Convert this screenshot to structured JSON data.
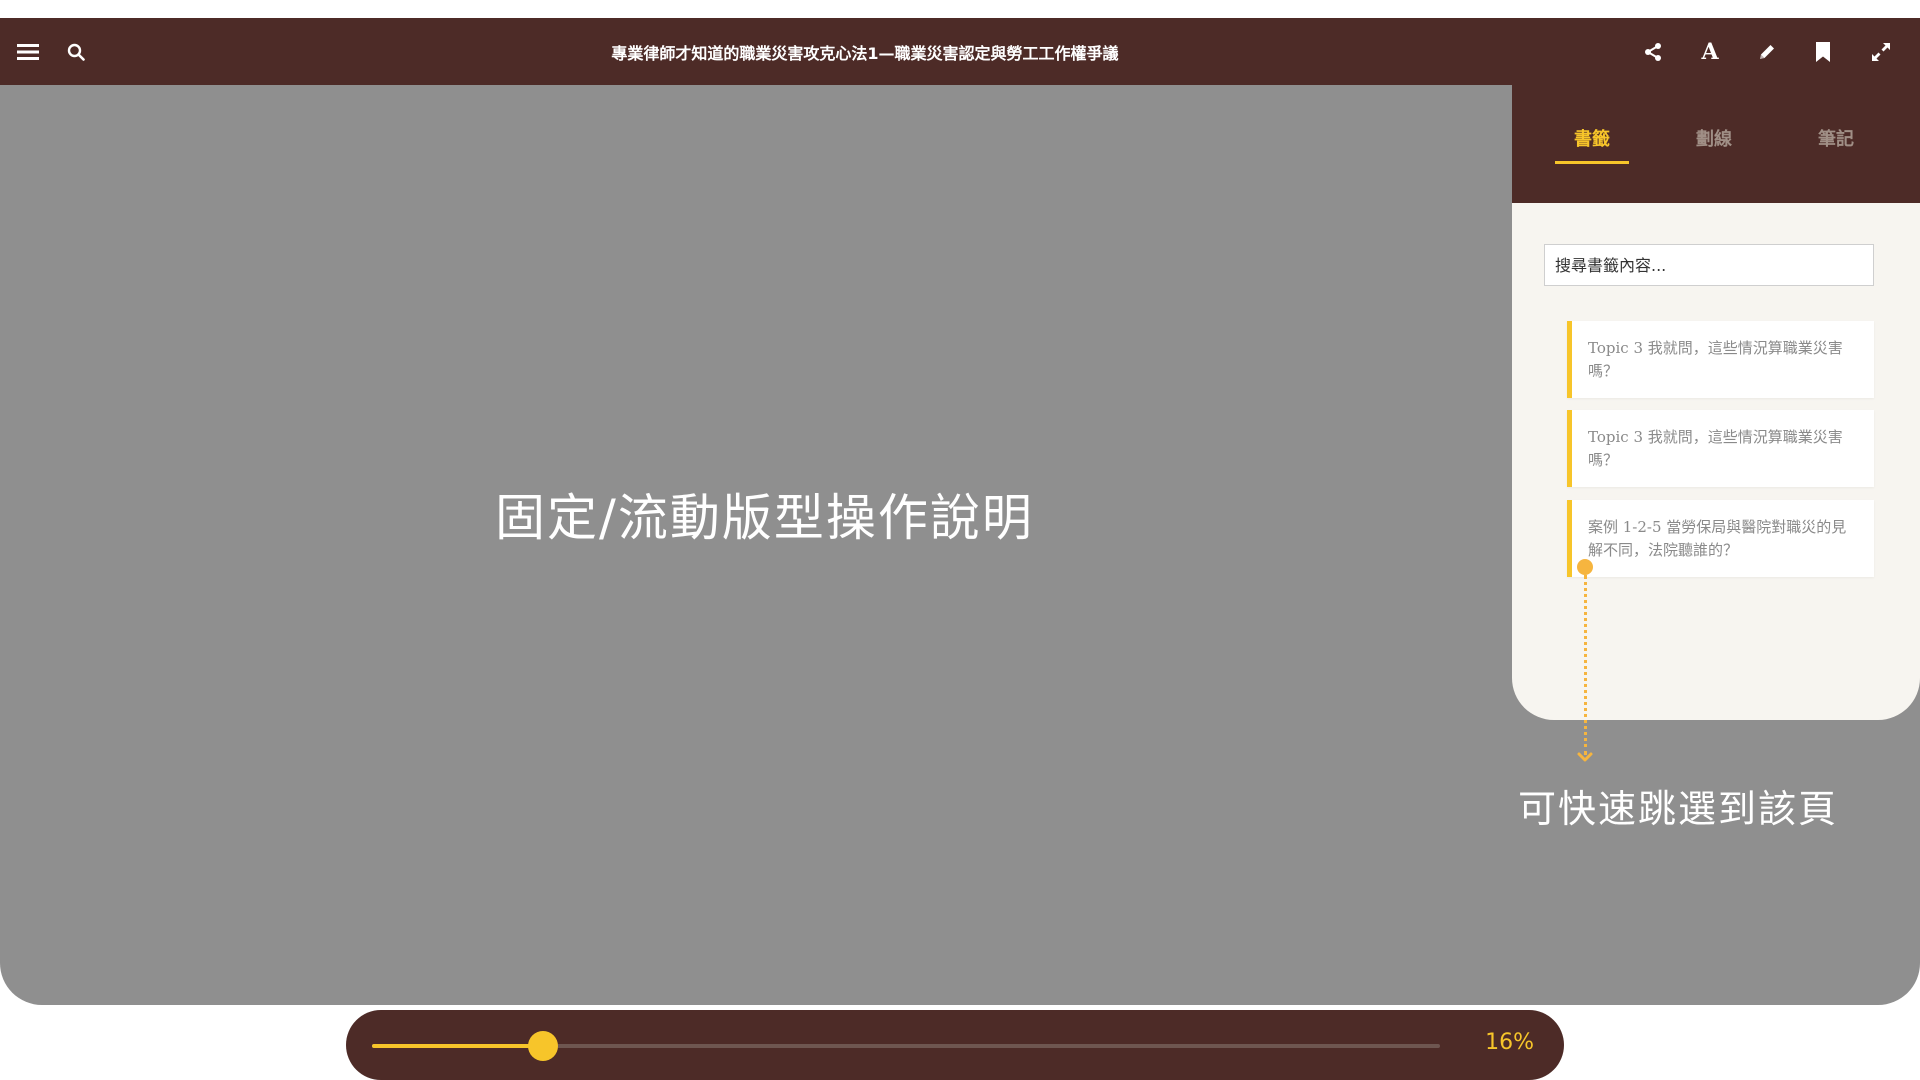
{
  "book": {
    "title": "專業律師才知道的職業災害攻克心法1—職業災害認定與勞工工作權爭議"
  },
  "toolbar": {
    "left": [
      {
        "name": "menu-icon",
        "glyph": "☰"
      },
      {
        "name": "search-icon",
        "glyph": "search"
      }
    ],
    "right": [
      {
        "name": "share-icon"
      },
      {
        "name": "font-icon",
        "glyph": "A"
      },
      {
        "name": "pencil-icon"
      },
      {
        "name": "bookmark-icon"
      },
      {
        "name": "fullscreen-icon"
      }
    ]
  },
  "overlay": {
    "title": "固定/流動版型操作說明",
    "callout": "可快速跳選到該頁"
  },
  "panel": {
    "tabs": [
      {
        "label": "書籤",
        "active": true
      },
      {
        "label": "劃線",
        "active": false
      },
      {
        "label": "筆記",
        "active": false
      }
    ],
    "search_placeholder": "搜尋書籤內容...",
    "bookmarks": [
      {
        "text": "Topic 3 我就問，這些情況算職業災害嗎？"
      },
      {
        "text": "Topic 3 我就問，這些情況算職業災害嗎？"
      },
      {
        "text": "案例 1-2-5 當勞保局與醫院對職災的見解不同，法院聽誰的？"
      }
    ]
  },
  "progress": {
    "value": 0.16,
    "label": "16%"
  },
  "colors": {
    "brand": "#4d2b27",
    "accent": "#f7c52a",
    "overlay": "#8f8f8f",
    "callout": "#f6b53f"
  }
}
